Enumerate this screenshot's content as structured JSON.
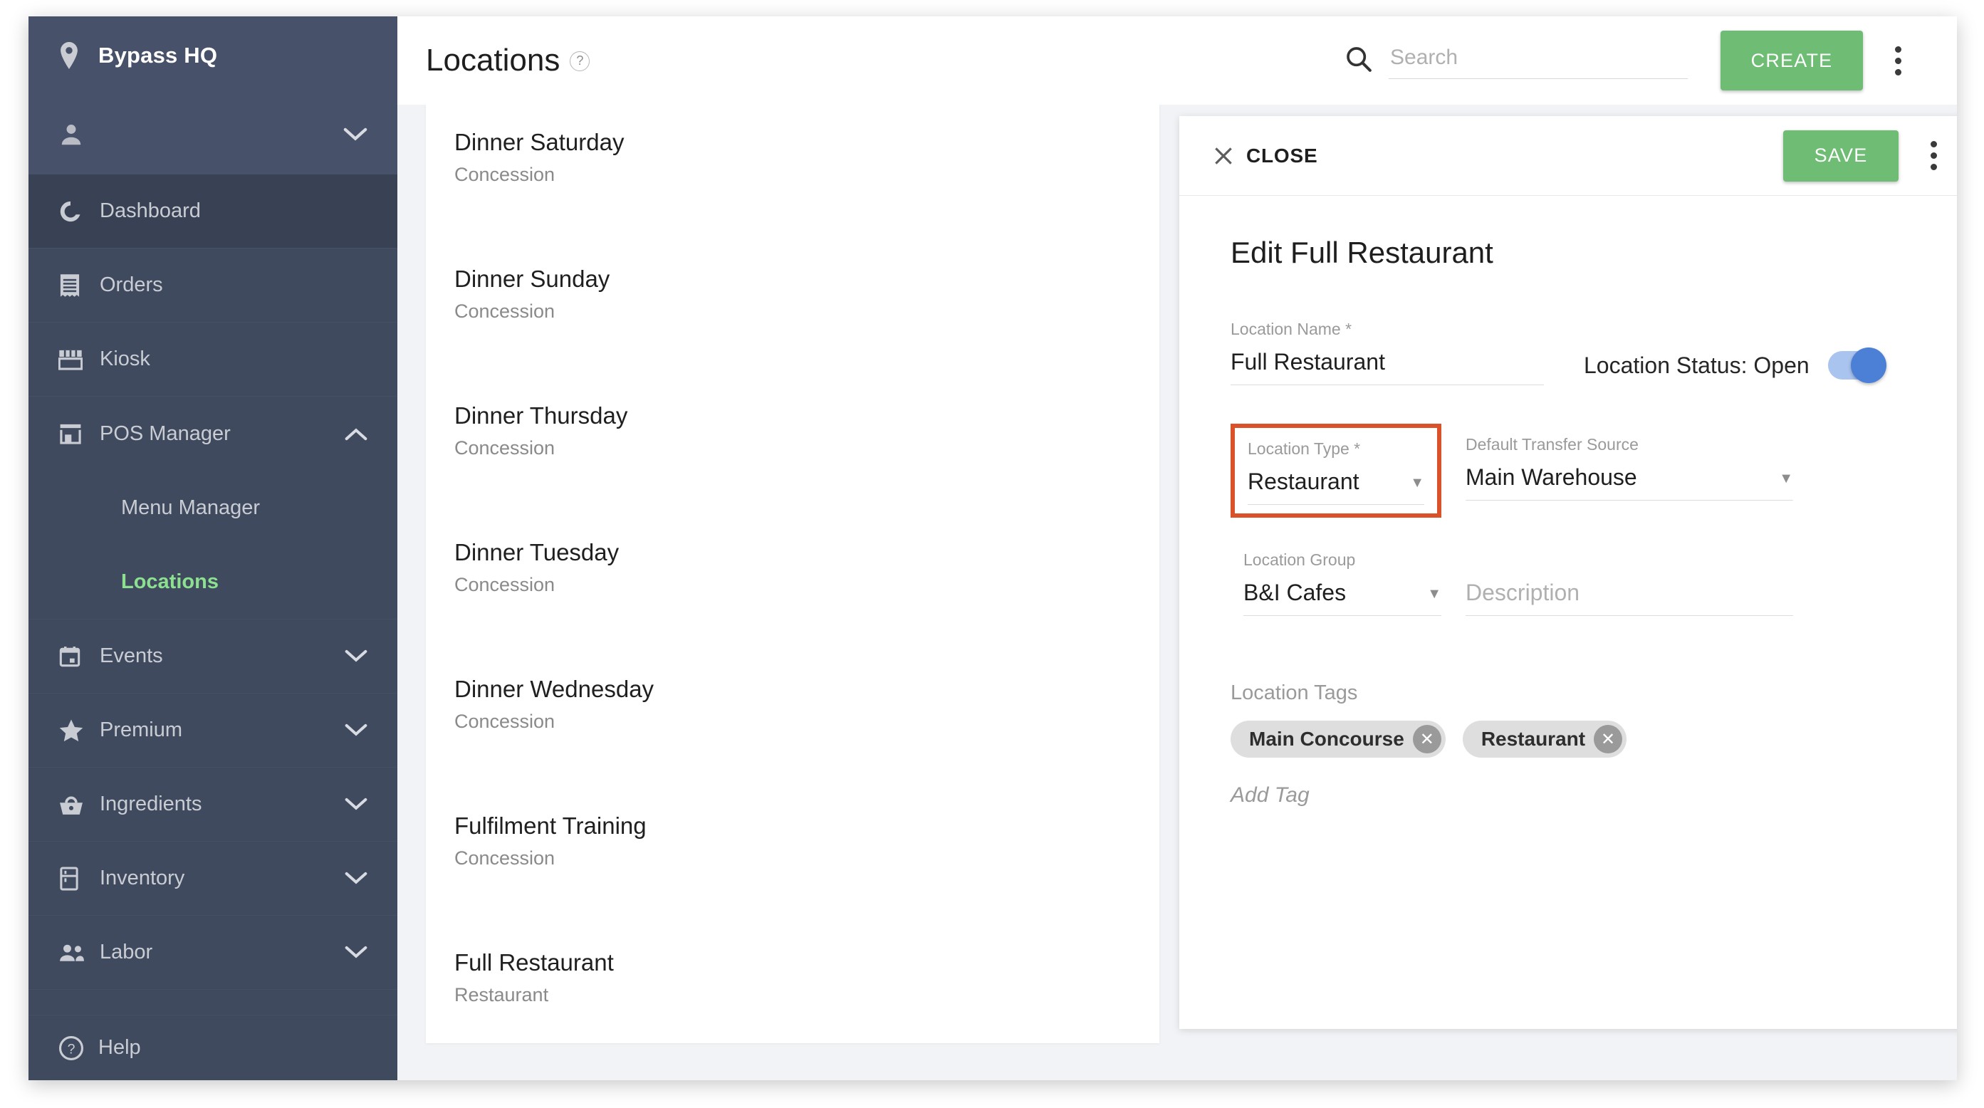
{
  "sidebar": {
    "brand": {
      "name": "Bypass HQ",
      "icon": "location-pin-icon"
    },
    "user_row": {
      "icon": "person-icon",
      "chevron": "chevron-down-icon"
    },
    "items": [
      {
        "label": "Dashboard",
        "icon": "dashboard-donut-icon",
        "chevron": "",
        "active_bg": true
      },
      {
        "label": "Orders",
        "icon": "receipt-icon",
        "chevron": "",
        "active_bg": false
      },
      {
        "label": "Kiosk",
        "icon": "kiosk-awning-icon",
        "chevron": "",
        "active_bg": false
      },
      {
        "label": "POS Manager",
        "icon": "storefront-icon",
        "chevron": "chevron-up-icon",
        "active_bg": false
      },
      {
        "label": "Events",
        "icon": "calendar-icon",
        "chevron": "chevron-down-icon",
        "active_bg": false
      },
      {
        "label": "Premium",
        "icon": "star-icon",
        "chevron": "chevron-down-icon",
        "active_bg": false
      },
      {
        "label": "Ingredients",
        "icon": "basket-icon",
        "chevron": "chevron-down-icon",
        "active_bg": false
      },
      {
        "label": "Inventory",
        "icon": "fridge-icon",
        "chevron": "chevron-down-icon",
        "active_bg": false
      },
      {
        "label": "Labor",
        "icon": "people-icon",
        "chevron": "chevron-down-icon",
        "active_bg": false
      }
    ],
    "pos_manager_children": [
      {
        "label": "Menu Manager",
        "active": false
      },
      {
        "label": "Locations",
        "active": true
      }
    ],
    "help": {
      "label": "Help",
      "icon": "help-circle-icon"
    },
    "colors": {
      "background": "#3f4a5f",
      "header_background": "#47526a",
      "active_text": "#8ce08f"
    }
  },
  "topbar": {
    "title": "Locations",
    "title_help_icon": "question-mark-circle-icon",
    "search": {
      "placeholder": "Search",
      "value": "",
      "icon": "search-icon"
    },
    "create_label": "CREATE",
    "overflow_icon": "vertical-dots-icon"
  },
  "locations_list": [
    {
      "name": "Dinner Saturday",
      "type": "Concession"
    },
    {
      "name": "Dinner Sunday",
      "type": "Concession"
    },
    {
      "name": "Dinner Thursday",
      "type": "Concession"
    },
    {
      "name": "Dinner Tuesday",
      "type": "Concession"
    },
    {
      "name": "Dinner Wednesday",
      "type": "Concession"
    },
    {
      "name": "Fulfilment Training",
      "type": "Concession"
    },
    {
      "name": "Full Restaurant",
      "type": "Restaurant"
    }
  ],
  "detail": {
    "close_label": "CLOSE",
    "close_icon": "close-x-icon",
    "save_label": "SAVE",
    "overflow_icon": "vertical-dots-icon",
    "title": "Edit Full Restaurant",
    "fields": {
      "location_name": {
        "label": "Location Name *",
        "value": "Full Restaurant"
      },
      "location_status": {
        "label": "Location Status: Open",
        "toggle_on": true
      },
      "location_type": {
        "label": "Location Type *",
        "value": "Restaurant",
        "caret": "▼",
        "highlighted": true
      },
      "default_transfer_source": {
        "label": "Default Transfer Source",
        "value": "Main Warehouse",
        "caret": "▼"
      },
      "location_group": {
        "label": "Location Group",
        "value": "B&I Cafes",
        "caret": "▼"
      },
      "description": {
        "placeholder": "Description",
        "value": ""
      }
    },
    "tags_section": {
      "label": "Location Tags",
      "tags": [
        {
          "text": "Main Concourse",
          "remove_icon": "close-x-icon"
        },
        {
          "text": "Restaurant",
          "remove_icon": "close-x-icon"
        }
      ],
      "add_tag_placeholder": "Add Tag"
    }
  },
  "colors": {
    "accent_green": "#6fbd74",
    "highlight_orange": "#d9522a",
    "toggle_on": "#4c80d6",
    "sidebar": "#3f4a5f"
  }
}
